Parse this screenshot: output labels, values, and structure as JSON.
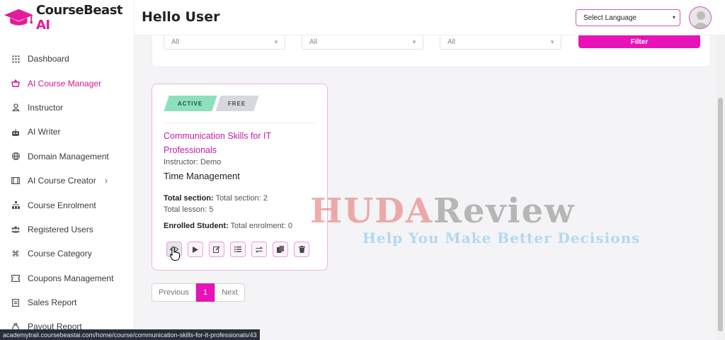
{
  "app": {
    "logo_main": "CourseBeast",
    "logo_ai": " AI",
    "greeting": "Hello User",
    "language_select": "Select Language"
  },
  "colors": {
    "accent": "#e812b8",
    "active_nav": "#d4178f",
    "badge_active": "#8ee0bd",
    "badge_free": "#d7d7df"
  },
  "sidebar": {
    "items": [
      {
        "label": "Dashboard",
        "icon": "grid-icon",
        "active": false
      },
      {
        "label": "AI Course Manager",
        "icon": "basket-icon",
        "active": true
      },
      {
        "label": "Instructor",
        "icon": "user-icon",
        "active": false
      },
      {
        "label": "AI Writer",
        "icon": "robot-icon",
        "active": false
      },
      {
        "label": "Domain Management",
        "icon": "globe-icon",
        "active": false
      },
      {
        "label": "AI Course Creator",
        "icon": "film-icon",
        "active": false,
        "has_submenu": true
      },
      {
        "label": "Course Enrolment",
        "icon": "hierarchy-icon",
        "active": false
      },
      {
        "label": "Registered Users",
        "icon": "users-icon",
        "active": false
      },
      {
        "label": "Course Category",
        "icon": "command-icon",
        "active": false
      },
      {
        "label": "Coupons Management",
        "icon": "ticket-icon",
        "active": false
      },
      {
        "label": "Sales Report",
        "icon": "report-icon",
        "active": false
      },
      {
        "label": "Payout Report",
        "icon": "money-bag-icon",
        "active": false
      }
    ]
  },
  "filters": {
    "select1": "All",
    "select2": "All",
    "select3": "All",
    "button": "Filter"
  },
  "course": {
    "badge_status": "ACTIVE",
    "badge_price": "FREE",
    "title": "Communication Skills for IT Professionals",
    "instructor": "Instructor: Demo",
    "category": "Time Management",
    "total_section_label": "Total section:",
    "total_section_value": "Total section: 2",
    "total_lesson": "Total lesson: 5",
    "enrolled_label": "Enrolled Student:",
    "enrolled_value": "Total enrolment: 0",
    "actions": [
      "view-icon",
      "play-icon",
      "edit-icon",
      "list-icon",
      "swap-icon",
      "copy-icon",
      "trash-icon"
    ]
  },
  "pagination": {
    "previous": "Previous",
    "current": "1",
    "next": "Next"
  },
  "watermark": {
    "main_red": "HUDA",
    "main_grey": "Review",
    "sub": "Help You Make Better Decisions"
  },
  "status_url": "academytrail.coursebeastai.com/home/course/communication-skills-for-it-professionals/43"
}
